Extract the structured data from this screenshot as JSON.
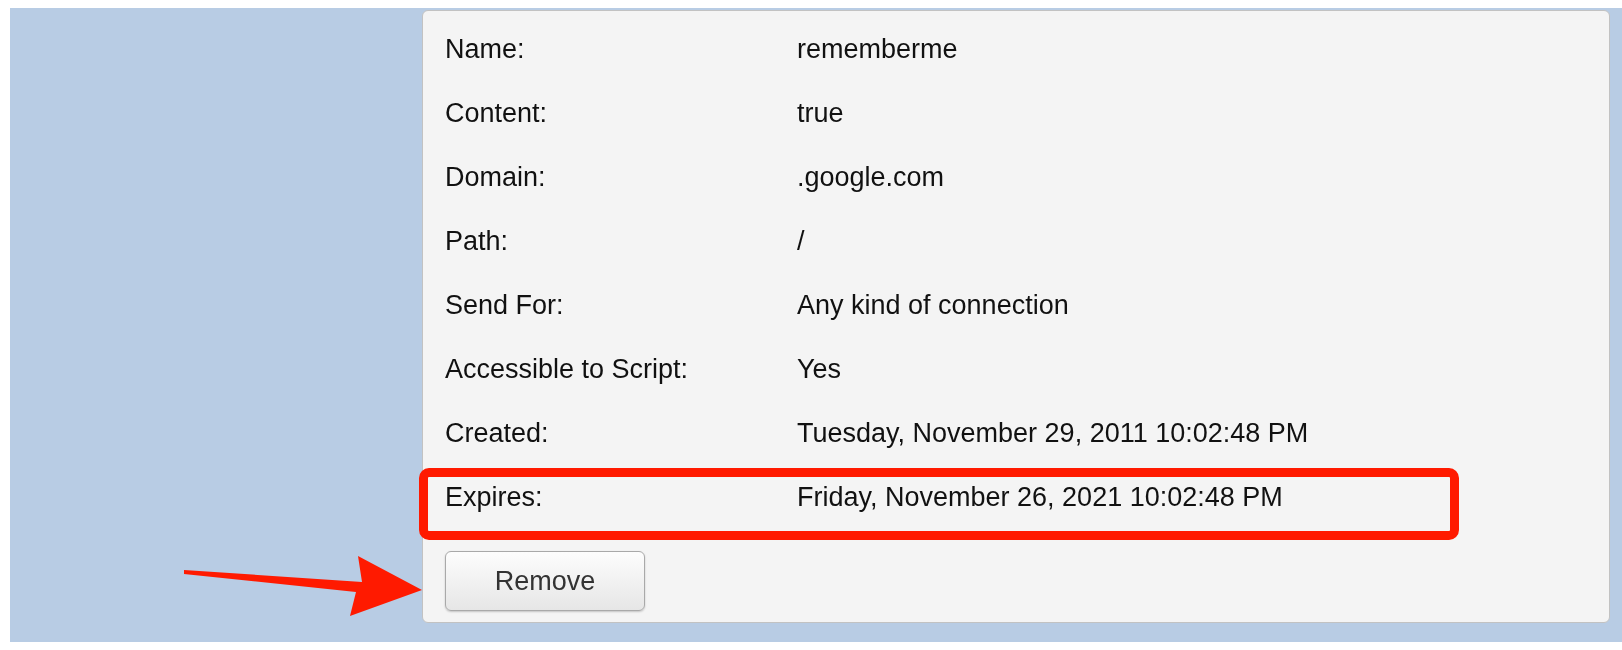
{
  "cookie_details": [
    {
      "label": "Name:",
      "value": "rememberme"
    },
    {
      "label": "Content:",
      "value": "true"
    },
    {
      "label": "Domain:",
      "value": ".google.com"
    },
    {
      "label": "Path:",
      "value": "/"
    },
    {
      "label": "Send For:",
      "value": "Any kind of connection"
    },
    {
      "label": "Accessible to Script:",
      "value": "Yes"
    },
    {
      "label": "Created:",
      "value": "Tuesday, November 29, 2011 10:02:48 PM"
    },
    {
      "label": "Expires:",
      "value": "Friday, November 26, 2021 10:02:48 PM"
    }
  ],
  "remove_button": {
    "label": "Remove"
  }
}
